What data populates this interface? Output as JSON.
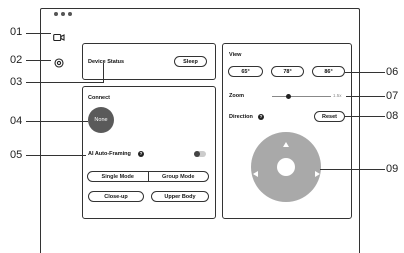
{
  "callouts": {
    "c01": "01",
    "c02": "02",
    "c03": "03",
    "c04": "04",
    "c05": "05",
    "c06": "06",
    "c07": "07",
    "c08": "08",
    "c09": "09"
  },
  "device_status": {
    "label": "Device Status",
    "sleep_button": "Sleep"
  },
  "connect": {
    "title": "Connect",
    "avatar_text": "None",
    "ai_framing_label": "AI Auto-Framing",
    "ai_framing_on": false,
    "single_mode": "Single Mode",
    "group_mode": "Group Mode",
    "close_up": "Close-up",
    "upper_body": "Upper Body"
  },
  "view": {
    "title": "View",
    "fov_options": [
      "65°",
      "78°",
      "86°"
    ],
    "zoom_label": "Zoom",
    "zoom_value": "1.5x",
    "zoom_level": 0.28,
    "direction_label": "Direction",
    "reset_button": "Reset"
  },
  "colors": {
    "dpad": "#a9a9a9",
    "avatar": "#5a5a5a",
    "toggle": "#444444"
  }
}
